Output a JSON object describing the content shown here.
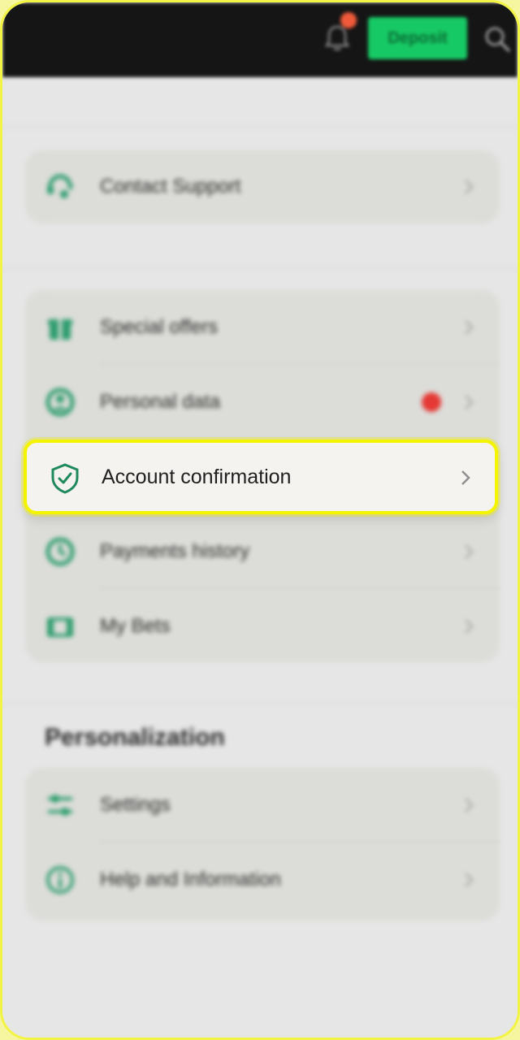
{
  "header": {
    "deposit_label": "Deposit",
    "notification_badge_color": "#ef5a3a",
    "icons": [
      "bell-icon",
      "search-icon"
    ]
  },
  "support": {
    "contact_label": "Contact Support",
    "icon": "headset-icon"
  },
  "account_menu": {
    "items": [
      {
        "label": "Special offers",
        "icon": "gift-icon"
      },
      {
        "label": "Personal data",
        "icon": "user-circle-icon",
        "alert": true
      },
      {
        "label": "Account confirmation",
        "icon": "shield-check-icon",
        "highlighted": true
      },
      {
        "label": "Payments history",
        "icon": "clock-icon"
      },
      {
        "label": "My Bets",
        "icon": "ticket-icon"
      }
    ]
  },
  "personalization": {
    "title": "Personalization",
    "items": [
      {
        "label": "Settings",
        "icon": "sliders-icon"
      },
      {
        "label": "Help and Information",
        "icon": "info-icon"
      }
    ]
  },
  "colors": {
    "accent": "#1e8a5b",
    "highlight_border": "#f4f400",
    "deposit_bg": "#17c964",
    "alert_dot": "#e53935"
  }
}
